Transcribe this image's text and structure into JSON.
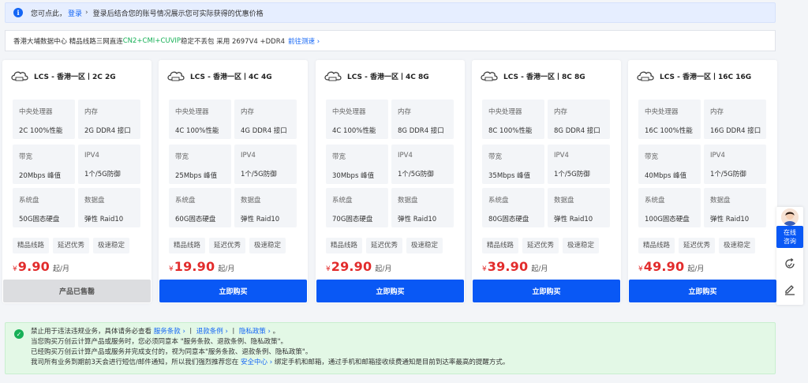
{
  "notice": {
    "text1": "您可点此，",
    "login": "登录",
    "sep": "›",
    "text2": "登录后结合您的账号情况展示您可实际获得的优惠价格"
  },
  "datacenter": {
    "pre": "香港大埔数据中心 精品线路三网直连 ",
    "highlight": "CN2+CMI+CUVIP",
    "post": " 稳定不丢包 采用 2697V4 +DDR4",
    "link": "前往测速",
    "arrow": "›"
  },
  "spec_labels": {
    "cpu": "中央处理器",
    "mem": "内存",
    "bw": "带宽",
    "ip": "IPV4",
    "sys": "系统盘",
    "data": "数据盘"
  },
  "cards": [
    {
      "title": "LCS - 香港一区丨2C 2G",
      "cpu": "2C 100%性能",
      "mem": "2G DDR4 接口",
      "bw": "20Mbps 峰值",
      "ip": "1个/5G防御",
      "sys": "50G固态硬盘",
      "data": "弹性 Raid10",
      "tags": [
        "精品线路",
        "延迟优秀",
        "极速稳定"
      ],
      "currency": "¥",
      "price": "9.90",
      "unit": "起/月",
      "button": "产品已售罄",
      "sold": true
    },
    {
      "title": "LCS - 香港一区丨4C 4G",
      "cpu": "4C 100%性能",
      "mem": "4G DDR4 接口",
      "bw": "25Mbps 峰值",
      "ip": "1个/5G防御",
      "sys": "60G固态硬盘",
      "data": "弹性 Raid10",
      "tags": [
        "精品线路",
        "延迟优秀",
        "极速稳定"
      ],
      "currency": "¥",
      "price": "19.90",
      "unit": "起/月",
      "button": "立即购买",
      "sold": false
    },
    {
      "title": "LCS - 香港一区丨4C 8G",
      "cpu": "4C 100%性能",
      "mem": "8G DDR4 接口",
      "bw": "30Mbps 峰值",
      "ip": "1个/5G防御",
      "sys": "70G固态硬盘",
      "data": "弹性 Raid10",
      "tags": [
        "精品线路",
        "延迟优秀",
        "极速稳定"
      ],
      "currency": "¥",
      "price": "29.90",
      "unit": "起/月",
      "button": "立即购买",
      "sold": false
    },
    {
      "title": "LCS - 香港一区丨8C 8G",
      "cpu": "8C 100%性能",
      "mem": "8G DDR4 接口",
      "bw": "35Mbps 峰值",
      "ip": "1个/5G防御",
      "sys": "80G固态硬盘",
      "data": "弹性 Raid10",
      "tags": [
        "精品线路",
        "延迟优秀",
        "极速稳定"
      ],
      "currency": "¥",
      "price": "39.90",
      "unit": "起/月",
      "button": "立即购买",
      "sold": false
    },
    {
      "title": "LCS - 香港一区丨16C 16G",
      "cpu": "16C 100%性能",
      "mem": "16G DDR4 接口",
      "bw": "40Mbps 峰值",
      "ip": "1个/5G防御",
      "sys": "100G固态硬盘",
      "data": "弹性 Raid10",
      "tags": [
        "精品线路",
        "延迟优秀",
        "极速稳定"
      ],
      "currency": "¥",
      "price": "49.90",
      "unit": "起/月",
      "button": "立即购买",
      "sold": false
    }
  ],
  "bottom": {
    "l1_pre": "禁止用于违法违规业务，具体请务必查看",
    "terms": "服务条款",
    "refund": "退款条例",
    "privacy": "隐私政策",
    "arrow": "›",
    "bar": "丨",
    "l1_post": "。",
    "line2": "当您购买万创云计算产品或服务时，您必须同意本 \"服务条款、退款条例、隐私政策\"。",
    "line3": "已经购买万创云计算产品或服务并完成支付的，视为同意本\"服务条款、退款条例、隐私政策\"。",
    "l4_pre": "我司所有业务到期前3天会进行短信/邮件通知，所以我们强烈推荐您在",
    "security": "安全中心",
    "l4_post": "绑定手机和邮箱，通过手机和邮箱接收续费通知是目前到达率最高的提醒方式。"
  },
  "float": {
    "chat_line1": "在线",
    "chat_line2": "咨询"
  },
  "icons": {
    "info": "info-icon",
    "check": "check-circle-icon",
    "cloud": "cloud-server-icon",
    "refresh": "refresh-icon",
    "edit": "edit-icon",
    "avatar": "support-avatar"
  },
  "colors": {
    "primary": "#0958f5",
    "price": "#e22c2c",
    "green": "#17b057"
  }
}
